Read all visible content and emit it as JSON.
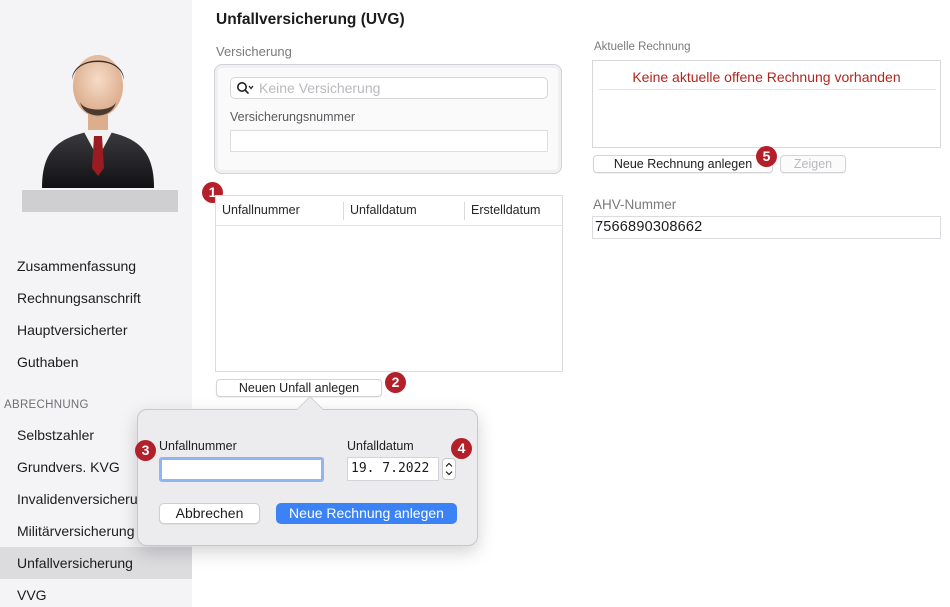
{
  "page": {
    "title": "Unfallversicherung (UVG)"
  },
  "sidebar": {
    "items_top": [
      "Zusammenfassung",
      "Rechnungsanschrift",
      "Hauptversicherter",
      "Guthaben"
    ],
    "section_label": "ABRECHNUNG",
    "items_bottom": [
      "Selbstzahler",
      "Grundvers. KVG",
      "Invalidenversicherung",
      "Militärversicherung",
      "Unfallversicherung",
      "VVG"
    ],
    "selected": "Unfallversicherung"
  },
  "versicherung": {
    "label": "Versicherung",
    "search_placeholder": "Keine Versicherung",
    "nummer_label": "Versicherungsnummer",
    "nummer_value": ""
  },
  "unfall_table": {
    "columns": [
      "Unfallnummer",
      "Unfalldatum",
      "Erstelldatum"
    ],
    "rows": []
  },
  "buttons": {
    "neuer_unfall": "Neuen Unfall anlegen",
    "neue_rechnung": "Neue Rechnung anlegen",
    "zeigen": "Zeigen"
  },
  "aktuelle_rechnung": {
    "label": "Aktuelle Rechnung",
    "message": "Keine aktuelle offene Rechnung vorhanden"
  },
  "ahv": {
    "label": "AHV-Nummer",
    "value": "7566890308662"
  },
  "popover": {
    "unfallnummer_label": "Unfallnummer",
    "unfallnummer_value": "",
    "unfalldatum_label": "Unfalldatum",
    "unfalldatum_value": "19.  7.2022",
    "cancel_label": "Abbrechen",
    "submit_label": "Neue Rechnung anlegen"
  },
  "badges": [
    "1",
    "2",
    "3",
    "4",
    "5"
  ],
  "colors": {
    "accent": "#3b82f6",
    "badge": "#b3202a",
    "warning_text": "#b3261e"
  }
}
